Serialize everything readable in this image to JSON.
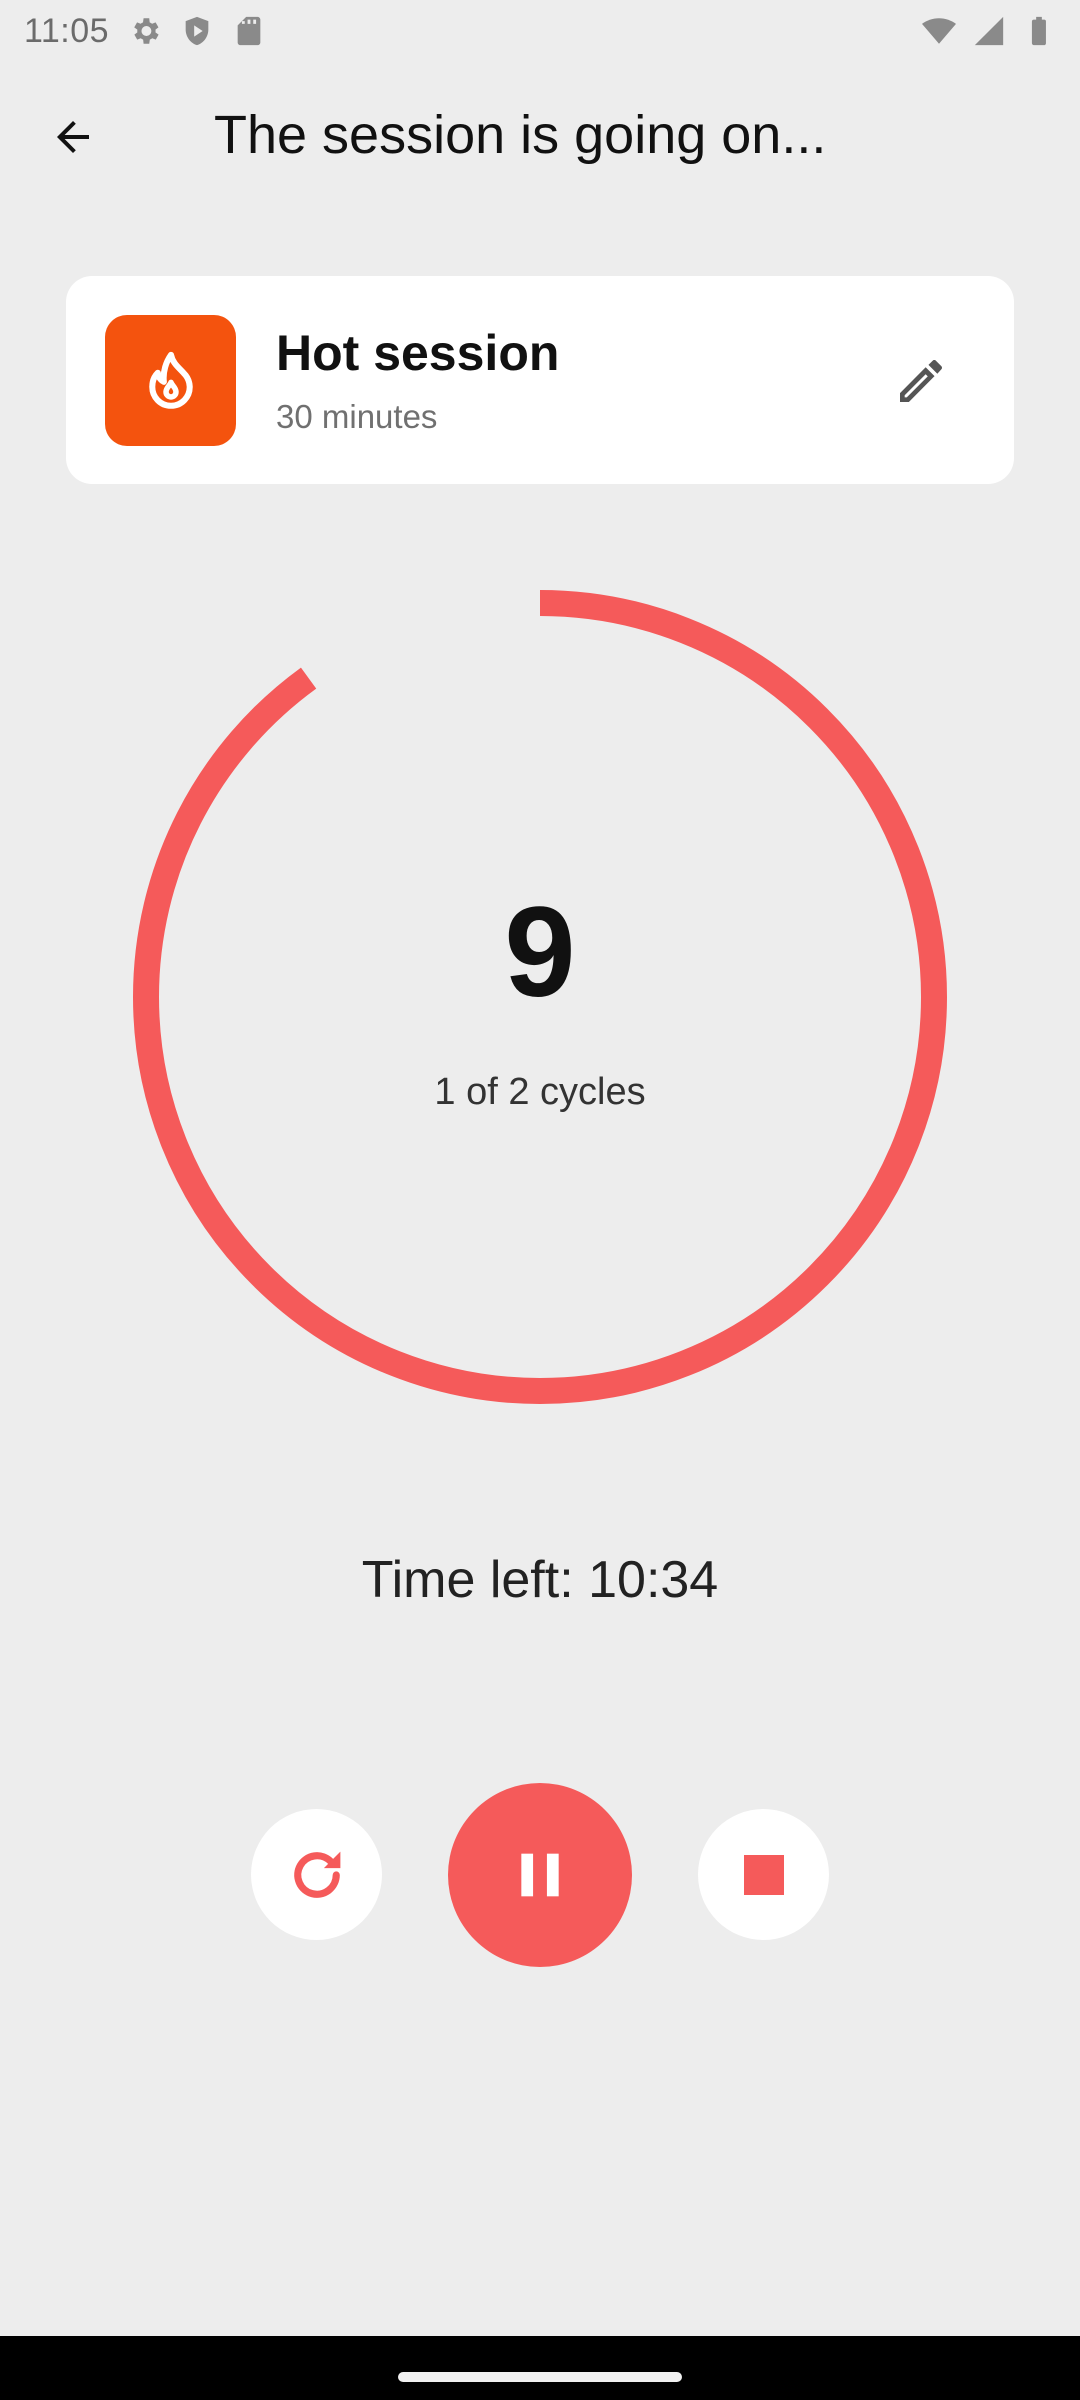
{
  "status_bar": {
    "time": "11:05",
    "icons_left": [
      "settings-icon",
      "shield-icon",
      "sim-card-icon"
    ],
    "icons_right": [
      "wifi-icon",
      "signal-icon",
      "battery-icon"
    ]
  },
  "app_bar": {
    "back_icon": "arrow-back-icon",
    "title": "The session is going on..."
  },
  "session": {
    "icon": "flame-icon",
    "name": "Hot session",
    "duration": "30 minutes",
    "edit_icon": "pencil-icon",
    "icon_color": "#f4530e"
  },
  "progress": {
    "value": 9,
    "cycle_label": "1 of 2 cycles",
    "ring_fraction": 0.9,
    "ring_color": "#f55a5a"
  },
  "time_left": "Time left: 10:34",
  "controls": {
    "restart_icon": "restart-icon",
    "pause_icon": "pause-icon",
    "stop_icon": "stop-icon",
    "accent": "#f55a5a"
  },
  "colors": {
    "background": "#ededed",
    "card": "#ffffff",
    "accent": "#f55a5a"
  }
}
